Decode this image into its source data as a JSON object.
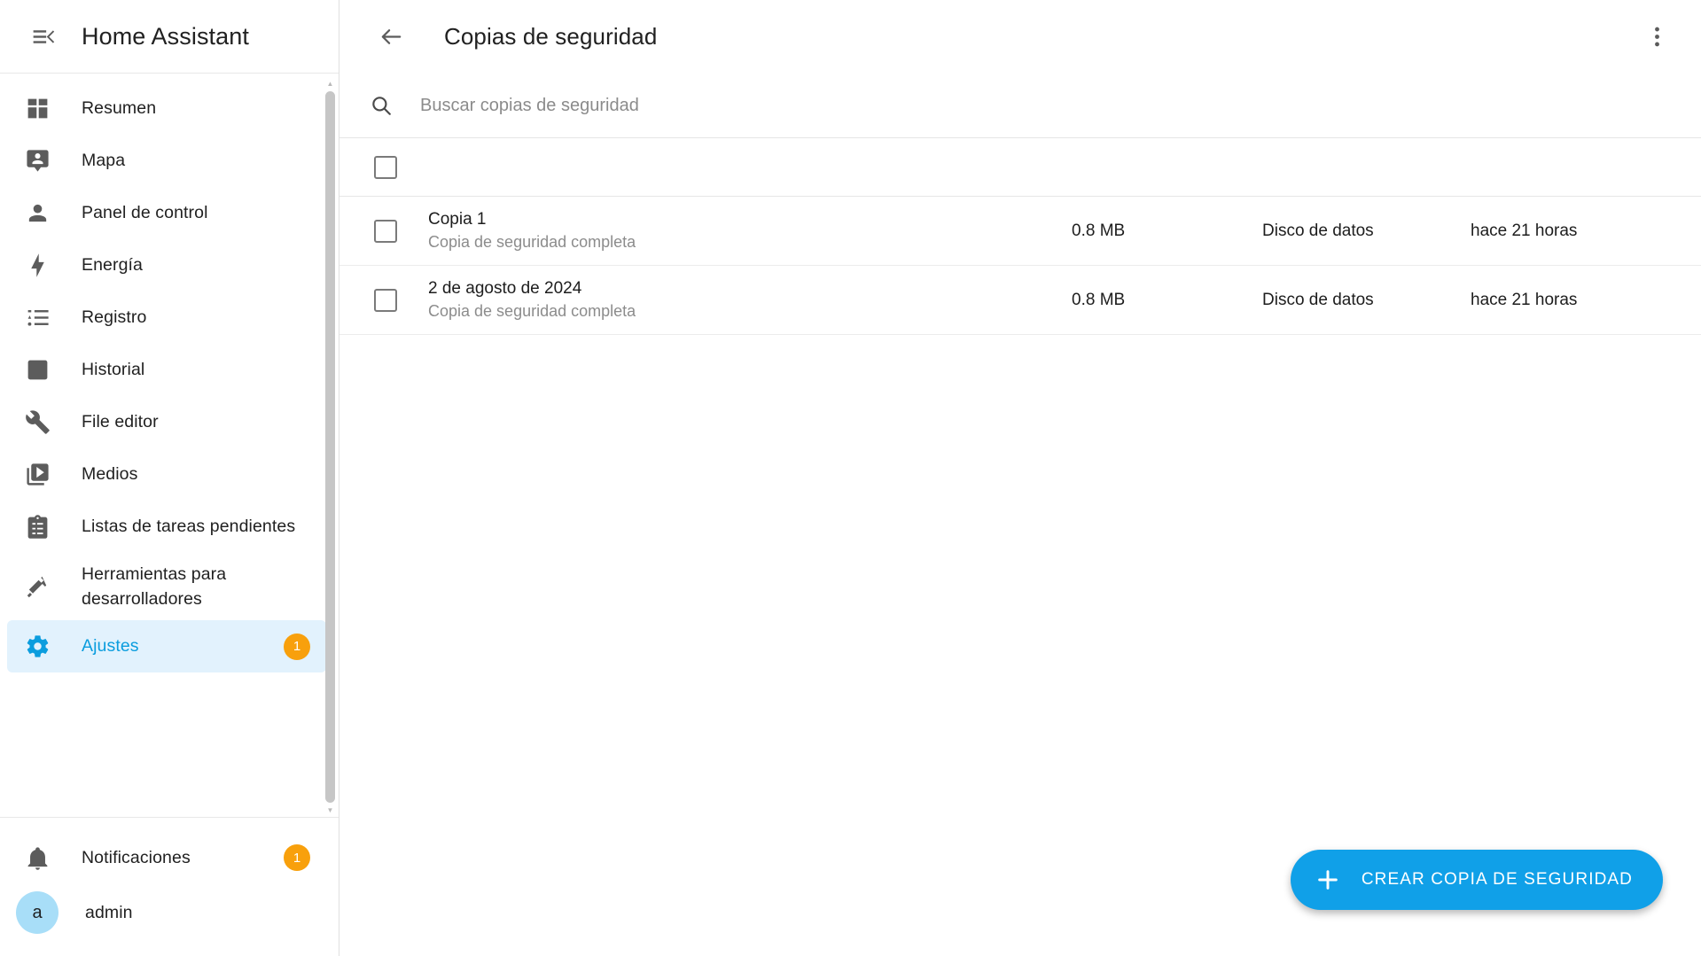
{
  "sidebar": {
    "brand": "Home Assistant",
    "menu_icon": "menu-collapse-icon",
    "items": [
      {
        "label": "Resumen",
        "icon": "view-dashboard-icon"
      },
      {
        "label": "Mapa",
        "icon": "map-marker-account-icon"
      },
      {
        "label": "Panel de control",
        "icon": "account-icon"
      },
      {
        "label": "Energía",
        "icon": "lightning-bolt-icon"
      },
      {
        "label": "Registro",
        "icon": "format-list-bulleted-icon"
      },
      {
        "label": "Historial",
        "icon": "chart-box-icon"
      },
      {
        "label": "File editor",
        "icon": "wrench-icon"
      },
      {
        "label": "Medios",
        "icon": "play-box-multiple-icon"
      },
      {
        "label": "Listas de tareas pendientes",
        "icon": "clipboard-list-icon"
      },
      {
        "label": "Herramientas para desarrolladores",
        "icon": "hammer-wrench-icon"
      },
      {
        "label": "Ajustes",
        "icon": "cog-icon",
        "badge": "1",
        "active": true
      }
    ],
    "footer": {
      "notifications_label": "Notificaciones",
      "notifications_badge": "1",
      "notifications_icon": "bell-icon",
      "user_label": "admin",
      "user_initial": "a"
    }
  },
  "toolbar": {
    "back_icon": "arrow-left-icon",
    "title": "Copias de seguridad",
    "overflow_icon": "dots-vertical-icon"
  },
  "search": {
    "icon": "search-icon",
    "placeholder": "Buscar copias de seguridad",
    "value": ""
  },
  "table": {
    "select_all_checked": false,
    "rows": [
      {
        "name": "Copia 1",
        "subtitle": "Copia de seguridad completa",
        "size": "0.8 MB",
        "location": "Disco de datos",
        "time": "hace 21 horas",
        "checked": false
      },
      {
        "name": "2 de agosto de 2024",
        "subtitle": "Copia de seguridad completa",
        "size": "0.8 MB",
        "location": "Disco de datos",
        "time": "hace 21 horas",
        "checked": false
      }
    ]
  },
  "fab": {
    "icon": "plus-icon",
    "label": "CREAR COPIA DE SEGURIDAD"
  },
  "colors": {
    "accent": "#10a0e8",
    "active_bg": "#e2f2fd",
    "badge": "#f8a00c",
    "avatar_bg": "#a8def8"
  }
}
